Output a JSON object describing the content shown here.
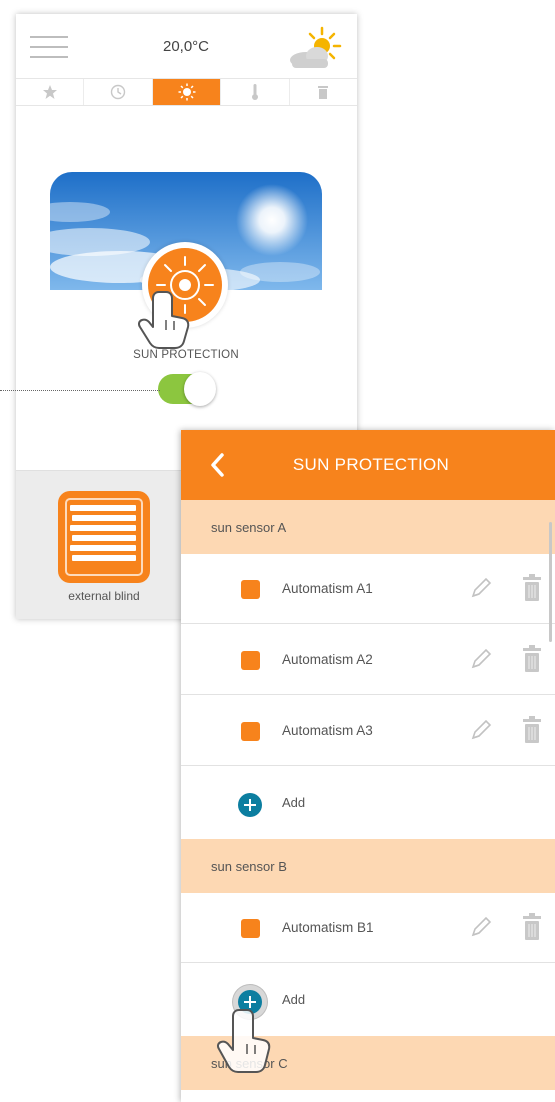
{
  "phone1": {
    "temperature": "20,0°C",
    "icons": {
      "menu": "hamburger-icon",
      "weather": "sun-cloud-icon"
    },
    "tabs": [
      {
        "icon": "star-icon",
        "active": false
      },
      {
        "icon": "clock-icon",
        "active": false
      },
      {
        "icon": "sun-icon",
        "active": true
      },
      {
        "icon": "thermometer-icon",
        "active": false
      },
      {
        "icon": "trash-icon",
        "active": false
      }
    ],
    "scene": {
      "label": "SUN PROTECTION",
      "toggle_on": true
    },
    "device": {
      "label": "external blind",
      "icon": "blind-icon"
    }
  },
  "phone2": {
    "title": "SUN PROTECTION",
    "back_icon": "chevron-left-icon",
    "sections": [
      {
        "name": "sun sensor A",
        "automatisms": [
          "Automatism A1",
          "Automatism A2",
          "Automatism A3"
        ],
        "add_label": "Add"
      },
      {
        "name": "sun sensor B",
        "automatisms": [
          "Automatism B1"
        ],
        "add_label": "Add"
      },
      {
        "name": "sun sensor C",
        "automatisms": []
      }
    ]
  },
  "colors": {
    "accent": "#f7831c",
    "section_bg": "#fdd8b3",
    "add_button": "#0c7ea0",
    "toggle_on": "#8cc63f"
  }
}
